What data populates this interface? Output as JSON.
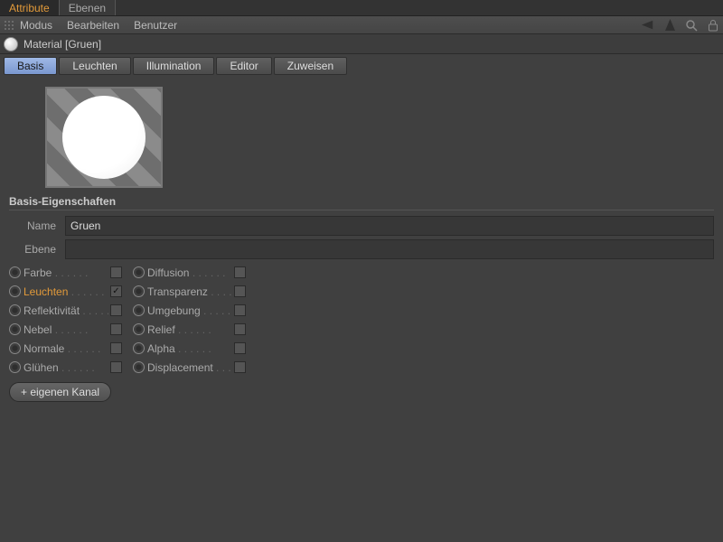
{
  "topTabs": {
    "active": "Attribute",
    "inactive": "Ebenen"
  },
  "menu": {
    "modus": "Modus",
    "bearbeiten": "Bearbeiten",
    "benutzer": "Benutzer"
  },
  "header": {
    "title": "Material [Gruen]"
  },
  "subtabs": {
    "basis": "Basis",
    "leuchten": "Leuchten",
    "illumination": "Illumination",
    "editor": "Editor",
    "zuweisen": "Zuweisen"
  },
  "section": {
    "title": "Basis-Eigenschaften"
  },
  "fields": {
    "nameLabel": "Name",
    "nameValue": "Gruen",
    "ebeneLabel": "Ebene",
    "ebeneValue": ""
  },
  "channels": {
    "col1": {
      "farbe": "Farbe",
      "leuchten": "Leuchten",
      "reflektivitaet": "Reflektivität",
      "nebel": "Nebel",
      "normale": "Normale",
      "gluehen": "Glühen"
    },
    "checked": {
      "leuchten": true
    },
    "col2": {
      "diffusion": "Diffusion",
      "transparenz": "Transparenz",
      "umgebung": "Umgebung",
      "relief": "Relief",
      "alpha": "Alpha",
      "displacement": "Displacement"
    }
  },
  "addChannel": "+ eigenen Kanal"
}
